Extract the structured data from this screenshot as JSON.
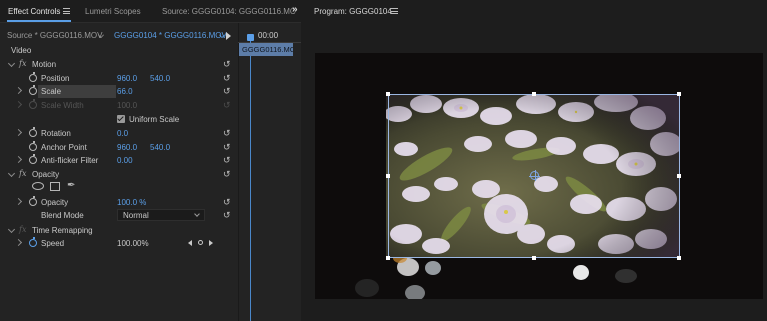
{
  "tabs": {
    "effect_controls": "Effect Controls",
    "lumetri_scopes": "Lumetri Scopes",
    "source": "Source: GGGG0104: GGGG0116.MC"
  },
  "source_bar": {
    "source": "Source * GGGG0116.MOV",
    "sequence_clip": "GGGG0104 * GGGG0116.MOV"
  },
  "timeline": {
    "timecode": "00:00",
    "clip_name": "GGGG0116.MO"
  },
  "sections": {
    "video": "Video",
    "motion": "Motion",
    "opacity": "Opacity",
    "time_remapping": "Time Remapping"
  },
  "motion": {
    "position": {
      "label": "Position",
      "x": "960.0",
      "y": "540.0"
    },
    "scale": {
      "label": "Scale",
      "value": "66.0"
    },
    "scale_width": {
      "label": "Scale Width",
      "value": "100.0"
    },
    "uniform_scale": {
      "label": "Uniform Scale",
      "checked": true
    },
    "rotation": {
      "label": "Rotation",
      "value": "0.0"
    },
    "anchor_point": {
      "label": "Anchor Point",
      "x": "960.0",
      "y": "540.0"
    },
    "anti_flicker": {
      "label": "Anti-flicker Filter",
      "value": "0.00"
    }
  },
  "opacity": {
    "opacity": {
      "label": "Opacity",
      "value": "100.0 %"
    },
    "blend_mode": {
      "label": "Blend Mode",
      "value": "Normal"
    }
  },
  "time_remapping": {
    "speed": {
      "label": "Speed",
      "value": "100.00%"
    }
  },
  "program": {
    "title": "Program: GGGG0104"
  },
  "colors": {
    "accent_blue": "#5b9fe8",
    "panel_bg": "#232323",
    "clip_blue": "#5d7da8"
  },
  "icons": [
    "hamburger-menu-icon",
    "panel-overflow-icon",
    "stopwatch-icon",
    "reset-icon",
    "fx-icon",
    "ellipse-mask-icon",
    "rectangle-mask-icon",
    "pen-mask-icon",
    "keyframe-nav-icon"
  ]
}
